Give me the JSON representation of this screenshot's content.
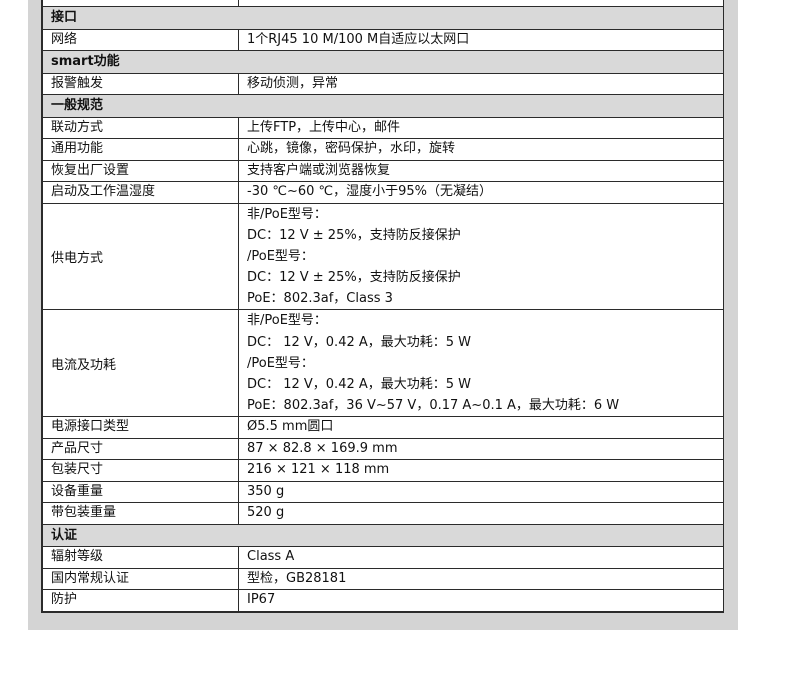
{
  "top_row": {
    "label": "",
    "value": ""
  },
  "sections": [
    {
      "title": "接口",
      "rows": [
        {
          "label": "网络",
          "lines": [
            "1个RJ45 10 M/100 M自适应以太网口"
          ]
        }
      ]
    },
    {
      "title": "smart功能",
      "rows": [
        {
          "label": "报警触发",
          "lines": [
            "移动侦测，异常"
          ]
        }
      ]
    },
    {
      "title": "一般规范",
      "rows": [
        {
          "label": "联动方式",
          "lines": [
            "上传FTP，上传中心，邮件"
          ]
        },
        {
          "label": "通用功能",
          "lines": [
            "心跳，镜像，密码保护，水印，旋转"
          ]
        },
        {
          "label": "恢复出厂设置",
          "lines": [
            "支持客户端或浏览器恢复"
          ]
        },
        {
          "label": "启动及工作温湿度",
          "lines": [
            "-30 ℃~60 ℃，湿度小于95%（无凝结）"
          ]
        },
        {
          "label": "供电方式",
          "lines": [
            "非/PoE型号：",
            "DC：12 V ± 25%，支持防反接保护",
            "/PoE型号：",
            "DC：12 V ± 25%，支持防反接保护",
            "PoE：802.3af，Class 3"
          ]
        },
        {
          "label": "电流及功耗",
          "lines": [
            "非/PoE型号：",
            "DC： 12 V，0.42 A，最大功耗：5 W",
            "/PoE型号：",
            "DC： 12 V，0.42 A，最大功耗：5 W",
            "PoE：802.3af，36 V~57 V，0.17 A~0.1 A，最大功耗：6 W"
          ]
        },
        {
          "label": "电源接口类型",
          "lines": [
            "Ø5.5 mm圆口"
          ]
        },
        {
          "label": "产品尺寸",
          "lines": [
            "87 × 82.8 × 169.9 mm"
          ]
        },
        {
          "label": "包装尺寸",
          "lines": [
            "216 × 121 × 118 mm"
          ]
        },
        {
          "label": "设备重量",
          "lines": [
            "350 g"
          ]
        },
        {
          "label": "带包装重量",
          "lines": [
            "520 g"
          ]
        }
      ]
    },
    {
      "title": "认证",
      "rows": [
        {
          "label": "辐射等级",
          "lines": [
            "Class A"
          ]
        },
        {
          "label": "国内常规认证",
          "lines": [
            "型检，GB28181"
          ]
        },
        {
          "label": "防护",
          "lines": [
            "IP67"
          ]
        }
      ]
    }
  ]
}
